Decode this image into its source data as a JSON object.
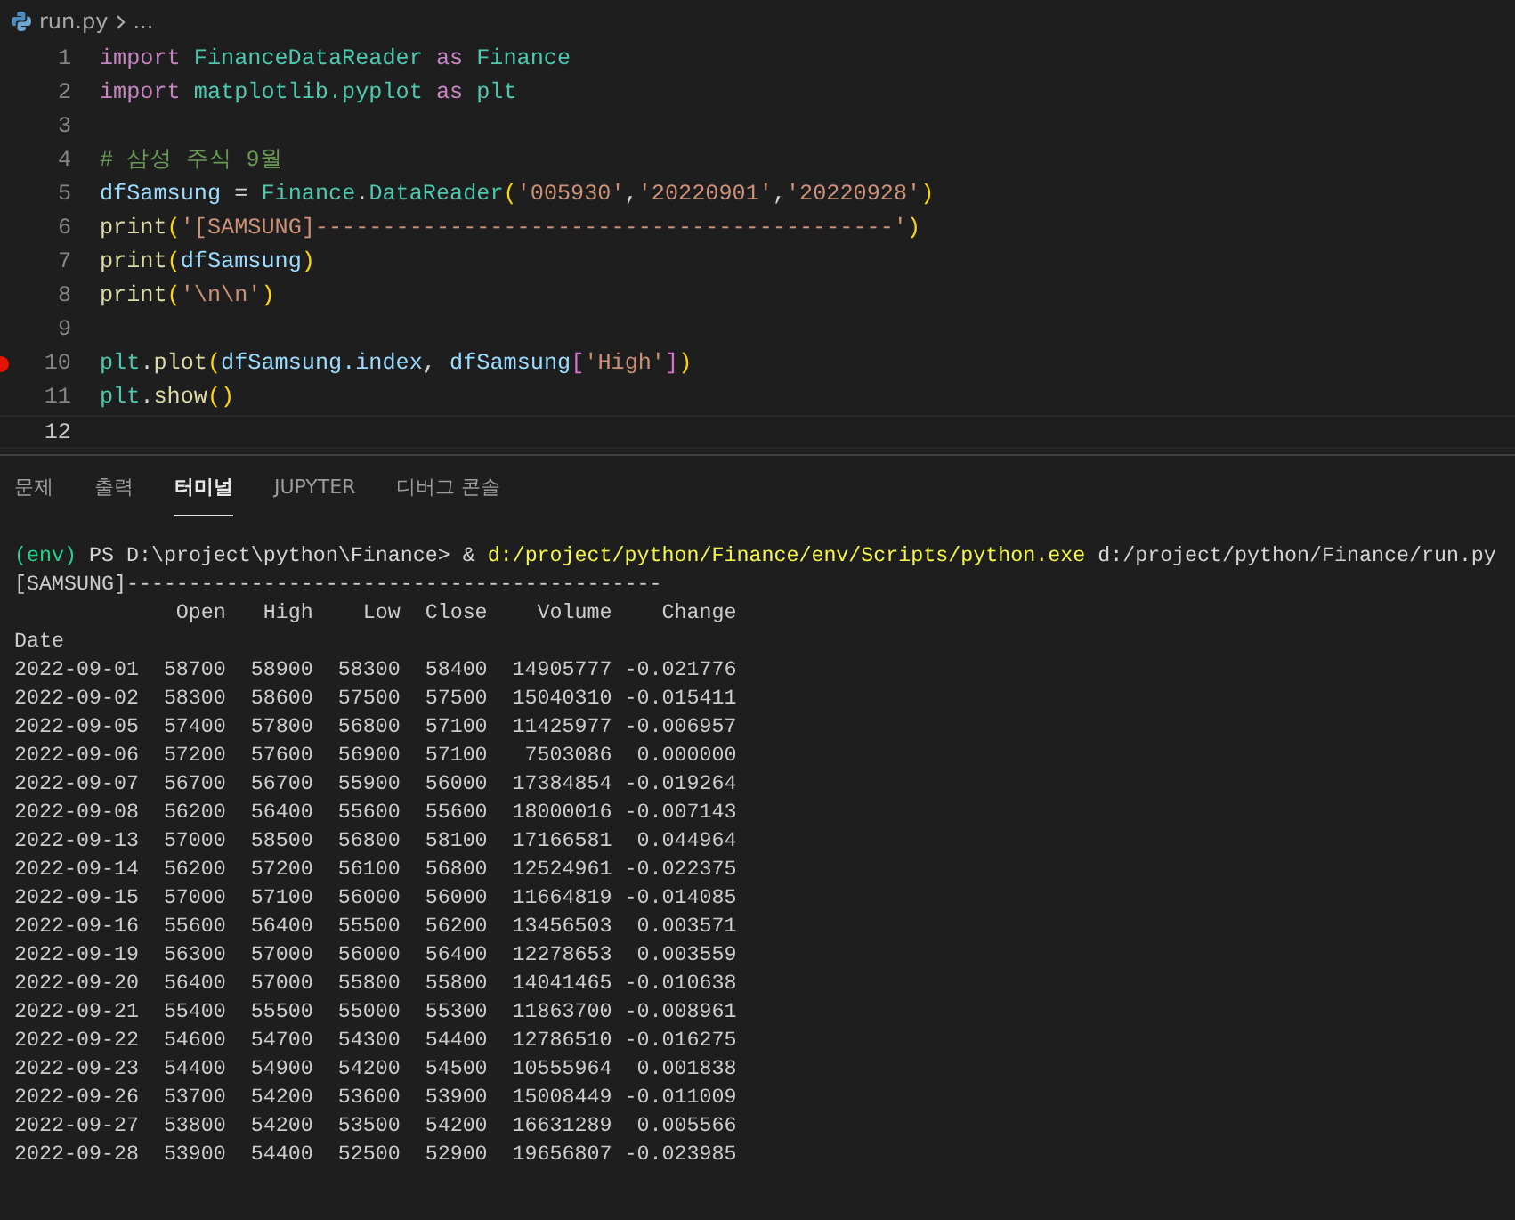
{
  "breadcrumb": {
    "file": "run.py",
    "trail": "..."
  },
  "editor": {
    "lines": [
      {
        "number": "1",
        "breakpoint": false,
        "current": false,
        "tokens": [
          {
            "kind": "keyword",
            "text": "import "
          },
          {
            "kind": "module",
            "text": "FinanceDataReader"
          },
          {
            "kind": "keyword",
            "text": " as "
          },
          {
            "kind": "module",
            "text": "Finance"
          }
        ]
      },
      {
        "number": "2",
        "breakpoint": false,
        "current": false,
        "tokens": [
          {
            "kind": "keyword",
            "text": "import "
          },
          {
            "kind": "module",
            "text": "matplotlib.pyplot"
          },
          {
            "kind": "keyword",
            "text": " as "
          },
          {
            "kind": "module",
            "text": "plt"
          }
        ]
      },
      {
        "number": "3",
        "breakpoint": false,
        "current": false
      },
      {
        "number": "4",
        "breakpoint": false,
        "current": false,
        "tokens": [
          {
            "kind": "comment",
            "text": "# 삼성 주식 9월"
          }
        ]
      },
      {
        "number": "5",
        "breakpoint": false,
        "current": false,
        "tokens": [
          {
            "kind": "variable",
            "text": "dfSamsung"
          },
          {
            "kind": "plain",
            "text": " = "
          },
          {
            "kind": "module",
            "text": "Finance"
          },
          {
            "kind": "plain",
            "text": "."
          },
          {
            "kind": "module",
            "text": "DataReader"
          },
          {
            "kind": "bracket1",
            "text": "("
          },
          {
            "kind": "string",
            "text": "'005930'"
          },
          {
            "kind": "plain",
            "text": ","
          },
          {
            "kind": "string",
            "text": "'20220901'"
          },
          {
            "kind": "plain",
            "text": ","
          },
          {
            "kind": "string",
            "text": "'20220928'"
          },
          {
            "kind": "bracket1",
            "text": ")"
          }
        ]
      },
      {
        "number": "6",
        "breakpoint": false,
        "current": false,
        "tokens": [
          {
            "kind": "function",
            "text": "print"
          },
          {
            "kind": "bracket1",
            "text": "("
          },
          {
            "kind": "string",
            "text": "'[SAMSUNG]-------------------------------------------'"
          },
          {
            "kind": "bracket1",
            "text": ")"
          }
        ]
      },
      {
        "number": "7",
        "breakpoint": false,
        "current": false,
        "tokens": [
          {
            "kind": "function",
            "text": "print"
          },
          {
            "kind": "bracket1",
            "text": "("
          },
          {
            "kind": "variable",
            "text": "dfSamsung"
          },
          {
            "kind": "bracket1",
            "text": ")"
          }
        ]
      },
      {
        "number": "8",
        "breakpoint": false,
        "current": false,
        "tokens": [
          {
            "kind": "function",
            "text": "print"
          },
          {
            "kind": "bracket1",
            "text": "("
          },
          {
            "kind": "string",
            "text": "'\\n\\n'"
          },
          {
            "kind": "bracket1",
            "text": ")"
          }
        ]
      },
      {
        "number": "9",
        "breakpoint": false,
        "current": false
      },
      {
        "number": "10",
        "breakpoint": true,
        "current": false,
        "tokens": [
          {
            "kind": "module",
            "text": "plt"
          },
          {
            "kind": "plain",
            "text": "."
          },
          {
            "kind": "function",
            "text": "plot"
          },
          {
            "kind": "bracket1",
            "text": "("
          },
          {
            "kind": "variable",
            "text": "dfSamsung.index"
          },
          {
            "kind": "plain",
            "text": ", "
          },
          {
            "kind": "variable",
            "text": "dfSamsung"
          },
          {
            "kind": "bracket2",
            "text": "["
          },
          {
            "kind": "string",
            "text": "'High'"
          },
          {
            "kind": "bracket2",
            "text": "]"
          },
          {
            "kind": "bracket1",
            "text": ")"
          }
        ]
      },
      {
        "number": "11",
        "breakpoint": false,
        "current": false,
        "tokens": [
          {
            "kind": "module",
            "text": "plt"
          },
          {
            "kind": "plain",
            "text": "."
          },
          {
            "kind": "function",
            "text": "show"
          },
          {
            "kind": "bracket1",
            "text": "()"
          }
        ]
      },
      {
        "number": "12",
        "breakpoint": false,
        "current": true
      }
    ]
  },
  "panel": {
    "tabs": [
      {
        "label": "문제",
        "selected": false
      },
      {
        "label": "출력",
        "selected": false
      },
      {
        "label": "터미널",
        "selected": true
      },
      {
        "label": "JUPYTER",
        "selected": false
      },
      {
        "label": "디버그 콘솔",
        "selected": false
      }
    ]
  },
  "terminal": {
    "prompt": [
      {
        "kind": "env",
        "text": "(env)"
      },
      {
        "kind": "plain",
        "text": " PS D:\\project\\python\\Finance> & "
      },
      {
        "kind": "command",
        "text": "d:/project/python/Finance/env/Scripts/python.exe"
      },
      {
        "kind": "plain",
        "text": " d:/project/python/Finance/run.py"
      }
    ],
    "lines": [
      "[SAMSUNG]-------------------------------------------",
      "             Open   High    Low  Close    Volume    Change",
      "Date",
      "2022-09-01  58700  58900  58300  58400  14905777 -0.021776",
      "2022-09-02  58300  58600  57500  57500  15040310 -0.015411",
      "2022-09-05  57400  57800  56800  57100  11425977 -0.006957",
      "2022-09-06  57200  57600  56900  57100   7503086  0.000000",
      "2022-09-07  56700  56700  55900  56000  17384854 -0.019264",
      "2022-09-08  56200  56400  55600  55600  18000016 -0.007143",
      "2022-09-13  57000  58500  56800  58100  17166581  0.044964",
      "2022-09-14  56200  57200  56100  56800  12524961 -0.022375",
      "2022-09-15  57000  57100  56000  56000  11664819 -0.014085",
      "2022-09-16  55600  56400  55500  56200  13456503  0.003571",
      "2022-09-19  56300  57000  56000  56400  12278653  0.003559",
      "2022-09-20  56400  57000  55800  55800  14041465 -0.010638",
      "2022-09-21  55400  55500  55000  55300  11863700 -0.008961",
      "2022-09-22  54600  54700  54300  54400  12786510 -0.016275",
      "2022-09-23  54400  54900  54200  54500  10555964  0.001838",
      "2022-09-26  53700  54200  53600  53900  15008449 -0.011009",
      "2022-09-27  53800  54200  53500  54200  16631289  0.005566",
      "2022-09-28  53900  54400  52500  52900  19656807 -0.023985"
    ]
  }
}
